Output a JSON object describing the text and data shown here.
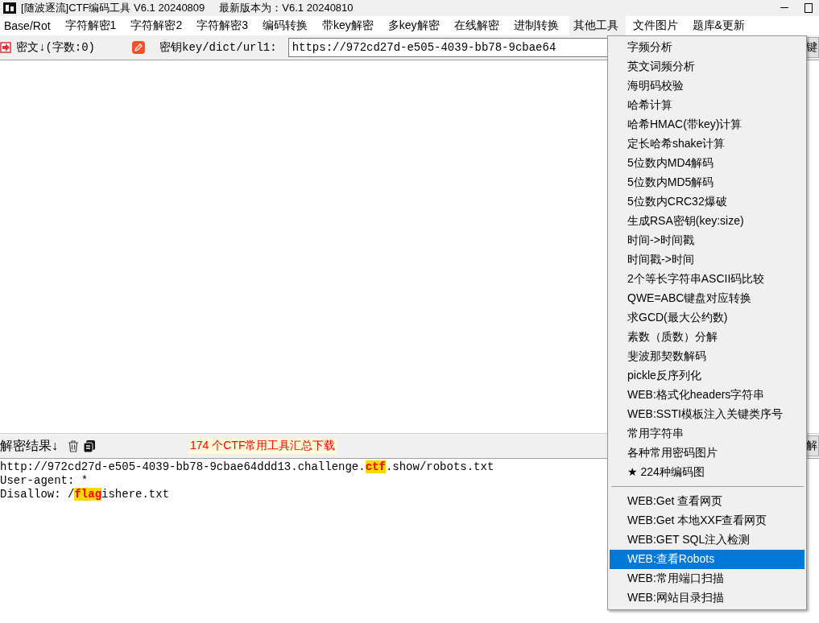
{
  "window": {
    "title": "[随波逐流]CTF编码工具 V6.1 20240809     最新版本为：V6.1 20240810"
  },
  "menubar": [
    {
      "label": "Base/Rot",
      "selected": false
    },
    {
      "label": "字符解密1",
      "selected": false
    },
    {
      "label": "字符解密2",
      "selected": false
    },
    {
      "label": "字符解密3",
      "selected": false
    },
    {
      "label": "编码转换",
      "selected": false
    },
    {
      "label": "带key解密",
      "selected": false
    },
    {
      "label": "多key解密",
      "selected": false
    },
    {
      "label": "在线解密",
      "selected": false
    },
    {
      "label": "进制转换",
      "selected": false
    },
    {
      "label": "其他工具",
      "selected": true
    },
    {
      "label": "文件图片",
      "selected": false
    },
    {
      "label": "题库&更新",
      "selected": false
    }
  ],
  "input_bar": {
    "cipher_label": "密文↓(字数:0)",
    "key_label": "密钥key/dict/url1:",
    "key_value": "https://972cd27d-e505-4039-bb78-9cbae64",
    "right_button": "键"
  },
  "result_bar": {
    "label": "解密结果↓",
    "promo": "174 个CTF常用工具汇总下载",
    "right_button": "解"
  },
  "output": [
    [
      {
        "text": "http://972cd27d-e505-4039-bb78-9cbae64ddd13.challenge.",
        "highlight": false
      },
      {
        "text": "ctf",
        "highlight": true
      },
      {
        "text": ".show/robots.txt",
        "highlight": false
      }
    ],
    [
      {
        "text": "User-agent: *",
        "highlight": false
      }
    ],
    [
      {
        "text": "Disallow: /",
        "highlight": false
      },
      {
        "text": "flag",
        "highlight": true
      },
      {
        "text": "ishere.txt",
        "highlight": false
      }
    ]
  ],
  "dropdown": [
    {
      "kind": "item",
      "label": "字频分析",
      "selected": false
    },
    {
      "kind": "item",
      "label": "英文词频分析",
      "selected": false
    },
    {
      "kind": "item",
      "label": "海明码校验",
      "selected": false
    },
    {
      "kind": "item",
      "label": "哈希计算",
      "selected": false
    },
    {
      "kind": "item",
      "label": "哈希HMAC(带key)计算",
      "selected": false
    },
    {
      "kind": "item",
      "label": "定长哈希shake计算",
      "selected": false
    },
    {
      "kind": "item",
      "label": "5位数内MD4解码",
      "selected": false
    },
    {
      "kind": "item",
      "label": "5位数内MD5解码",
      "selected": false
    },
    {
      "kind": "item",
      "label": "5位数内CRC32爆破",
      "selected": false
    },
    {
      "kind": "item",
      "label": "生成RSA密钥(key:size)",
      "selected": false
    },
    {
      "kind": "item",
      "label": "时间->时间戳",
      "selected": false
    },
    {
      "kind": "item",
      "label": "时间戳->时间",
      "selected": false
    },
    {
      "kind": "item",
      "label": "2个等长字符串ASCII码比较",
      "selected": false
    },
    {
      "kind": "item",
      "label": "QWE=ABC键盘对应转换",
      "selected": false
    },
    {
      "kind": "item",
      "label": "求GCD(最大公约数)",
      "selected": false
    },
    {
      "kind": "item",
      "label": "素数（质数）分解",
      "selected": false
    },
    {
      "kind": "item",
      "label": "斐波那契数解码",
      "selected": false
    },
    {
      "kind": "item",
      "label": "pickle反序列化",
      "selected": false
    },
    {
      "kind": "item",
      "label": "WEB:格式化headers字符串",
      "selected": false
    },
    {
      "kind": "item",
      "label": "WEB:SSTI模板注入关键类序号",
      "selected": false
    },
    {
      "kind": "item",
      "label": "常用字符串",
      "selected": false
    },
    {
      "kind": "item",
      "label": "各种常用密码图片",
      "selected": false
    },
    {
      "kind": "item",
      "label": "★ 224种编码图",
      "selected": false
    },
    {
      "kind": "separator"
    },
    {
      "kind": "item",
      "label": "WEB:Get 查看网页",
      "selected": false
    },
    {
      "kind": "item",
      "label": "WEB:Get 本地XXF查看网页",
      "selected": false
    },
    {
      "kind": "item",
      "label": "WEB:GET SQL注入检测",
      "selected": false
    },
    {
      "kind": "item",
      "label": "WEB:查看Robots",
      "selected": true
    },
    {
      "kind": "item",
      "label": "WEB:常用端口扫描",
      "selected": false
    },
    {
      "kind": "item",
      "label": "WEB:网站目录扫描",
      "selected": false
    }
  ]
}
